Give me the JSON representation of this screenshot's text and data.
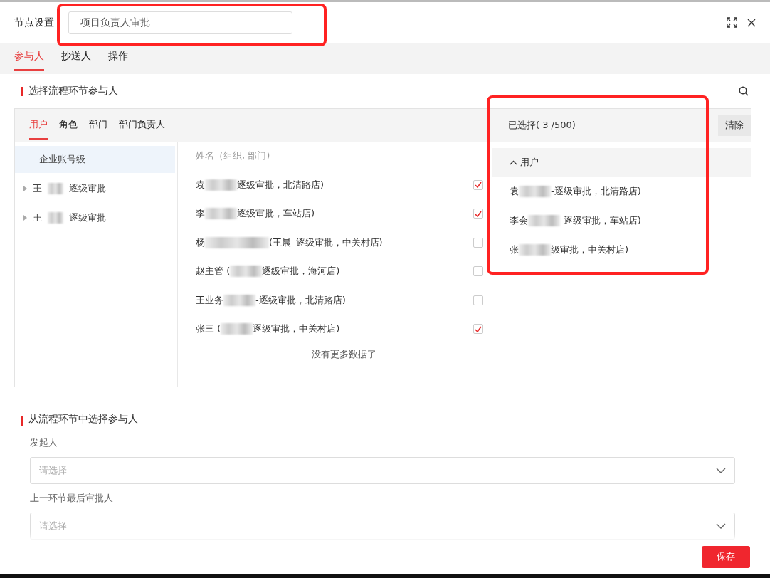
{
  "window": {
    "title": "节点设置",
    "name_field": {
      "value": "项目负责人审批"
    }
  },
  "tabs": [
    {
      "label": "参与人",
      "selected": true
    },
    {
      "label": "抄送人",
      "selected": false
    },
    {
      "label": "操作",
      "selected": false
    }
  ],
  "section_1": {
    "title": "选择流程环节参与人",
    "picker_tabs": [
      {
        "label": "用户",
        "selected": true
      },
      {
        "label": "角色",
        "selected": false
      },
      {
        "label": "部门",
        "selected": false
      },
      {
        "label": "部门负责人",
        "selected": false
      }
    ],
    "tree": [
      {
        "label": "企业账号级",
        "kind": "root",
        "selected": true
      },
      {
        "label": "王",
        "suffix": "逐级审批",
        "kind": "branch",
        "selected": false
      },
      {
        "label": "王",
        "suffix": "逐级审批",
        "kind": "branch",
        "selected": false
      }
    ],
    "list_header": {
      "name": "姓名",
      "hint": "（组织, 部门)"
    },
    "users": [
      {
        "name": "袁",
        "detail": "逐级审批，北清路店)",
        "checked": true
      },
      {
        "name": "李",
        "detail": "逐级审批，车站店)",
        "checked": true
      },
      {
        "name": "杨",
        "detail": "(王晨–逐级审批，中关村店)",
        "checked": false
      },
      {
        "name": "赵主管 (",
        "detail": "逐级审批，海河店)",
        "checked": false
      },
      {
        "name": "王业务",
        "detail": "-逐级审批，北清路店)",
        "checked": false
      },
      {
        "name": "张三 (",
        "detail": "逐级审批，中关村店)",
        "checked": true
      }
    ],
    "end_text": "没有更多数据了",
    "selected_panel": {
      "title": "已选择( 3 /500)",
      "clear_button": "清除",
      "group": {
        "label": "用户",
        "expanded": true
      },
      "items": [
        {
          "name": "袁",
          "detail": "-逐级审批，北清路店)"
        },
        {
          "name": "李会",
          "detail": "-逐级审批，车站店)"
        },
        {
          "name": "张",
          "detail": "级审批，中关村店)"
        }
      ]
    }
  },
  "section_2": {
    "title": "从流程环节中选择参与人",
    "fields": [
      {
        "label": "发起人",
        "placeholder": "请选择"
      },
      {
        "label": "上一环节最后审批人",
        "placeholder": "请选择"
      }
    ]
  },
  "save_button": "保存",
  "highlights": [
    {
      "kind": "frame"
    },
    {
      "kind": "frame"
    }
  ]
}
